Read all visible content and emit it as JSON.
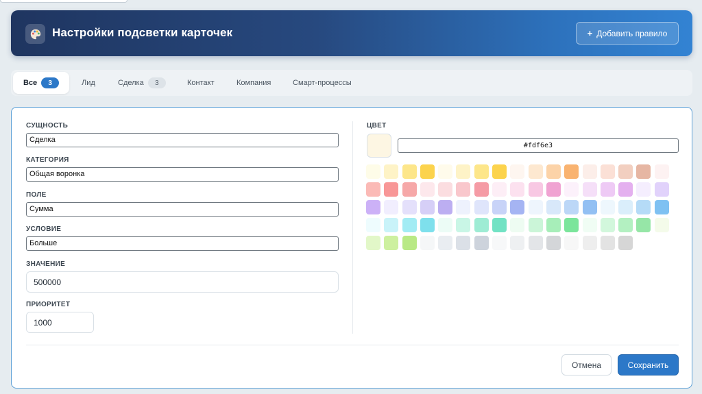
{
  "header": {
    "title": "Настройки подсветки карточек",
    "add_rule_label": "Добавить правило",
    "add_icon": "plus-icon",
    "app_icon": "palette-icon"
  },
  "tabs": [
    {
      "label": "Все",
      "count": "3",
      "active": true
    },
    {
      "label": "Лид",
      "count": null
    },
    {
      "label": "Сделка",
      "count": "3"
    },
    {
      "label": "Контакт",
      "count": null
    },
    {
      "label": "Компания",
      "count": null
    },
    {
      "label": "Смарт-процессы",
      "count": null
    }
  ],
  "form": {
    "entity": {
      "label": "СУЩНОСТЬ",
      "value": "Сделка"
    },
    "category": {
      "label": "КАТЕГОРИЯ",
      "value": "Общая воронка"
    },
    "field": {
      "label": "ПОЛЕ",
      "value": "Сумма"
    },
    "condition": {
      "label": "УСЛОВИЕ",
      "value": "Больше"
    },
    "value": {
      "label": "ЗНАЧЕНИЕ",
      "value": "500000"
    },
    "priority": {
      "label": "ПРИОРИТЕТ",
      "value": "1000"
    }
  },
  "color": {
    "label": "ЦВЕТ",
    "hex": "#fdf6e3",
    "palette": [
      "#fefce8",
      "#fef3c7",
      "#fde68a",
      "#fcd34d",
      "#fffbeb",
      "#fef3c7",
      "#fde68a",
      "#fcd34d",
      "#fef6f0",
      "#fde8d0",
      "#fcd3a8",
      "#f9b370",
      "#fceee9",
      "#fbe0d6",
      "#f2cfc0",
      "#e6b6a3",
      "#fdf2f2",
      "#fbbab6",
      "#f89797",
      "#f6a8a8",
      "#fde8ec",
      "#fbdde0",
      "#f9c7cc",
      "#f59ba5",
      "#fdeef6",
      "#fce1ef",
      "#f8c8e3",
      "#f0a3d2",
      "#fcf1fb",
      "#f5dff8",
      "#eecaf5",
      "#e4b0ef",
      "#f5eefe",
      "#e1d2fb",
      "#ccb1f7",
      "#f1eefe",
      "#e4e0fb",
      "#d6cff7",
      "#bcaef1",
      "#eef2fd",
      "#dfe5fb",
      "#c8d3f8",
      "#a5b4f3",
      "#eef5fd",
      "#d8e8fa",
      "#bcd7f7",
      "#93c0f3",
      "#eef7fd",
      "#daeefb",
      "#b5dbf7",
      "#7fc1f2",
      "#eefcfe",
      "#c9f3f9",
      "#a2ecf4",
      "#7ee0ec",
      "#ecfcf6",
      "#c9f6e6",
      "#9eecd4",
      "#72e2c4",
      "#eefcf2",
      "#cbf5d8",
      "#a7eeb9",
      "#7be59b",
      "#f0fdf4",
      "#d2f7dc",
      "#b3f0c1",
      "#96e6a7",
      "#f4fbea",
      "#e2f7c8",
      "#cdf09f",
      "#b9e985",
      "#f5f7f8",
      "#e9edf1",
      "#dbe0e7",
      "#cdd3dc",
      "#f7f8f9",
      "#eef0f2",
      "#e3e5e8",
      "#d4d6d9",
      "#f7f7f7",
      "#eeeeee",
      "#e3e3e3",
      "#d6d6d6"
    ]
  },
  "actions": {
    "cancel": "Отмена",
    "save": "Сохранить"
  }
}
